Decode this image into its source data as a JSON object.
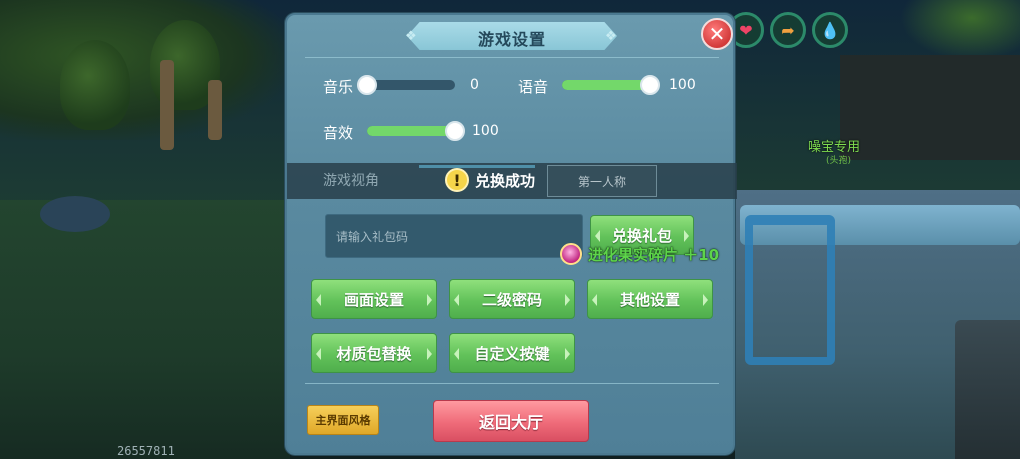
{
  "dialog": {
    "title": "游戏设置",
    "close_icon": "close-x-icon"
  },
  "audio": {
    "music_label": "音乐",
    "music_value": "0",
    "music_level": 0,
    "voice_label": "语音",
    "voice_value": "100",
    "voice_level": 100,
    "sfx_label": "音效",
    "sfx_value": "100",
    "sfx_level": 100
  },
  "view": {
    "label": "游戏视角",
    "second_tab": "第一人称"
  },
  "toast": {
    "icon": "warning-icon",
    "text": "兑换成功"
  },
  "gift": {
    "input_placeholder": "请输入礼包码",
    "redeem_button": "兑换礼包"
  },
  "reward": {
    "text": "进化果实碎片 ＋10",
    "icon": "evolution-fruit-icon"
  },
  "buttons": {
    "graphics": "画面设置",
    "secondary_password": "二级密码",
    "other_settings": "其他设置",
    "texture_pack": "材质包替换",
    "custom_keys": "自定义按键"
  },
  "footer": {
    "style_button": "主界面风格",
    "return_lobby": "返回大厅"
  },
  "hud": {
    "icons": [
      "heart-icon",
      "arrow-icon",
      "water-drop-icon"
    ]
  },
  "scene": {
    "npc_name": "噪宝专用",
    "npc_sub": "(头孢)",
    "user_id": "26557811"
  },
  "colors": {
    "accent_green": "#73d86a",
    "danger_red": "#ef6b79",
    "panel_blue": "#5a8aa0",
    "gold": "#f6cf5a"
  }
}
